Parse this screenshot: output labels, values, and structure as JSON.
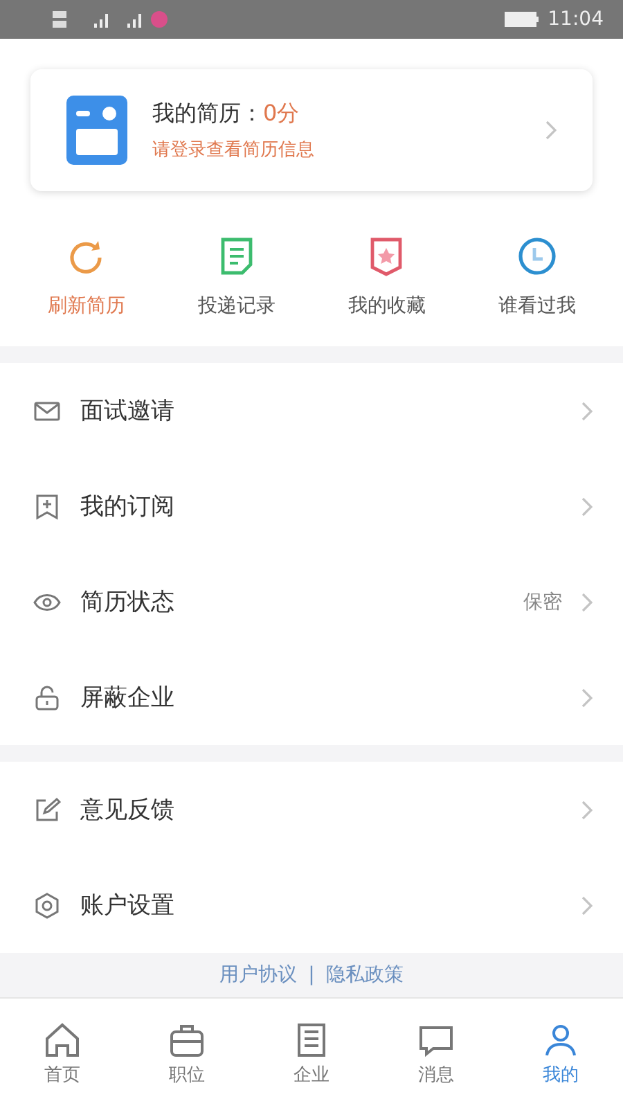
{
  "status_bar": {
    "time": "11:04"
  },
  "resume_card": {
    "title": "我的简历：",
    "score": "0分",
    "subtitle": "请登录查看简历信息"
  },
  "shortcuts": [
    {
      "kind": "refresh",
      "label": "刷新简历",
      "selected": true
    },
    {
      "kind": "record",
      "label": "投递记录",
      "selected": false
    },
    {
      "kind": "favorite",
      "label": "我的收藏",
      "selected": false
    },
    {
      "kind": "viewers",
      "label": "谁看过我",
      "selected": false
    }
  ],
  "menu_groups": [
    [
      {
        "kind": "mail",
        "label": "面试邀请"
      },
      {
        "kind": "bookmark",
        "label": "我的订阅"
      },
      {
        "kind": "eye",
        "label": "简历状态",
        "value": "保密"
      },
      {
        "kind": "lock",
        "label": "屏蔽企业"
      }
    ],
    [
      {
        "kind": "edit",
        "label": "意见反馈"
      },
      {
        "kind": "gear",
        "label": "账户设置"
      }
    ]
  ],
  "footer_links": [
    "用户协议",
    "隐私政策"
  ],
  "footer_separator": "|",
  "tabs": [
    {
      "kind": "home",
      "label": "首页",
      "selected": false
    },
    {
      "kind": "job",
      "label": "职位",
      "selected": false
    },
    {
      "kind": "company",
      "label": "企业",
      "selected": false
    },
    {
      "kind": "message",
      "label": "消息",
      "selected": false
    },
    {
      "kind": "me",
      "label": "我的",
      "selected": true
    }
  ]
}
